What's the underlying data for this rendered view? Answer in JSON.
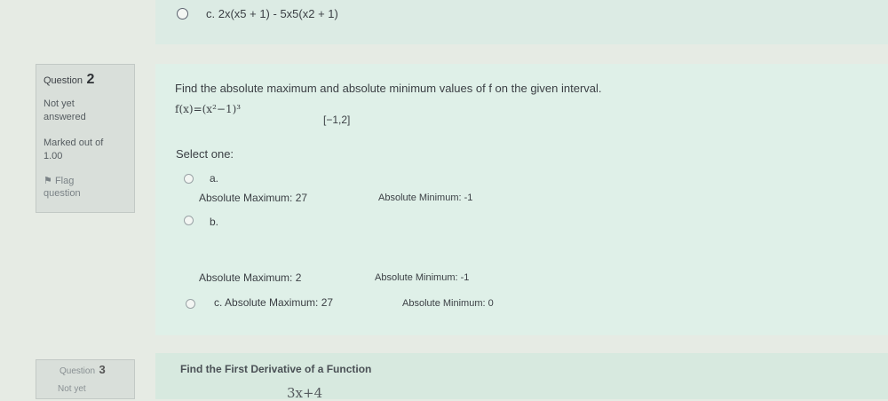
{
  "previous_option": {
    "label": "c. 2x(x5 + 1) - 5x5(x2 + 1)"
  },
  "question2": {
    "label": "Question",
    "number": "2",
    "status": [
      "Not yet",
      "answered"
    ],
    "marked": [
      "Marked out of",
      "1.00"
    ],
    "flag": [
      "Flag",
      "question"
    ],
    "prompt": "Find the absolute maximum and absolute minimum values of f on the given interval.",
    "function": "f(x)=(x²−1)³",
    "interval": "[−1,2]",
    "select_one": "Select one:",
    "options": [
      {
        "letter": "a.",
        "max": "Absolute Maximum: 27",
        "min": "Absolute Minimum: -1"
      },
      {
        "letter": "b.",
        "max": "Absolute Maximum: 2",
        "min": "Absolute Minimum: -1"
      },
      {
        "letter": "c.",
        "max": "Absolute Maximum: 27",
        "min": "Absolute Minimum: 0"
      }
    ]
  },
  "question3": {
    "label": "Question",
    "number": "3",
    "status": "Not yet",
    "prompt": "Find the First Derivative of a Function",
    "function": "3x+4"
  },
  "colors": {
    "background": "#e6ebe4",
    "content": "#dff0e8",
    "info_box": "#d9dfda"
  }
}
